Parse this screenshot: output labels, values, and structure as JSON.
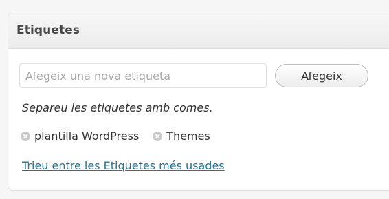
{
  "panel": {
    "title": "Etiquetes"
  },
  "tag_input": {
    "placeholder": "Afegeix una nova etiqueta",
    "value": ""
  },
  "add_button": {
    "label": "Afegeix"
  },
  "hint": "Separeu les etiquetes amb comes.",
  "tags": [
    {
      "label": "plantilla WordPress",
      "remove_icon": "remove-circle-icon"
    },
    {
      "label": "Themes",
      "remove_icon": "remove-circle-icon"
    }
  ],
  "tagcloud_link": "Trieu entre les Etiquetes més usades",
  "colors": {
    "link": "#21759b",
    "title": "#464646",
    "remove_icon": "#c9c9c9"
  }
}
